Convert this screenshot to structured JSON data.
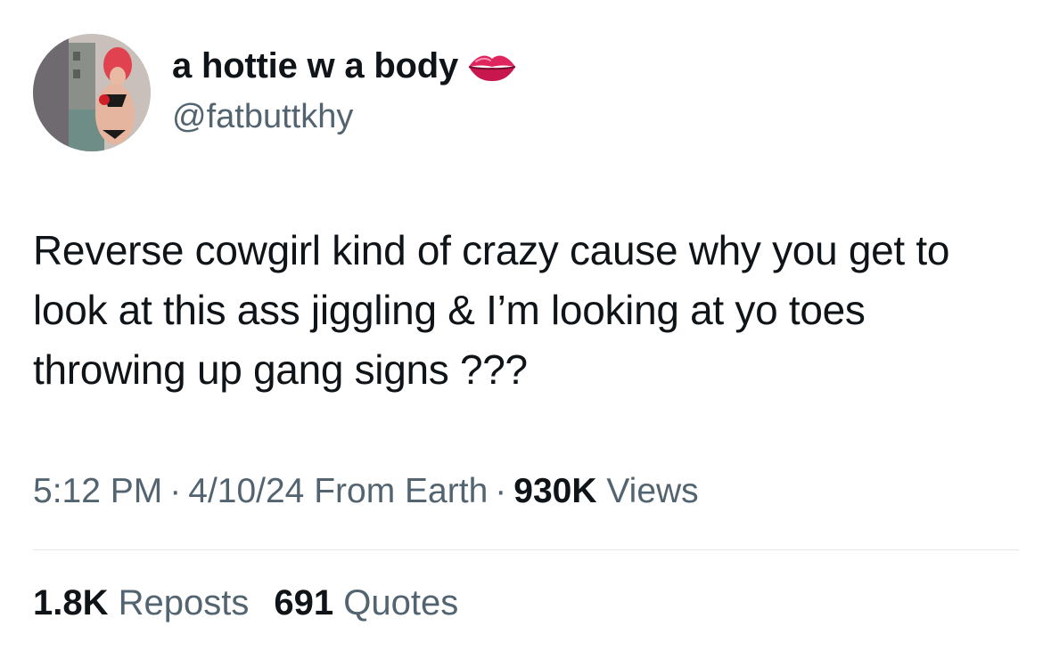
{
  "author": {
    "display_name": "a hottie w a body",
    "name_emoji": "lips-icon",
    "handle": "@fatbuttkhy"
  },
  "tweet": {
    "text": "Reverse cowgirl kind of crazy cause why you get to look at this ass jiggling & I’m looking at yo toes throwing up gang signs ???"
  },
  "meta": {
    "time": "5:12 PM",
    "date": "4/10/24",
    "source": "From Earth",
    "views_count": "930K",
    "views_label": "Views",
    "separator": "·"
  },
  "stats": {
    "reposts_count": "1.8K",
    "reposts_label": "Reposts",
    "quotes_count": "691",
    "quotes_label": "Quotes"
  },
  "colors": {
    "text_primary": "#0f1419",
    "text_secondary": "#536471",
    "divider": "#e1e6ea",
    "lips": "#e0245e"
  }
}
